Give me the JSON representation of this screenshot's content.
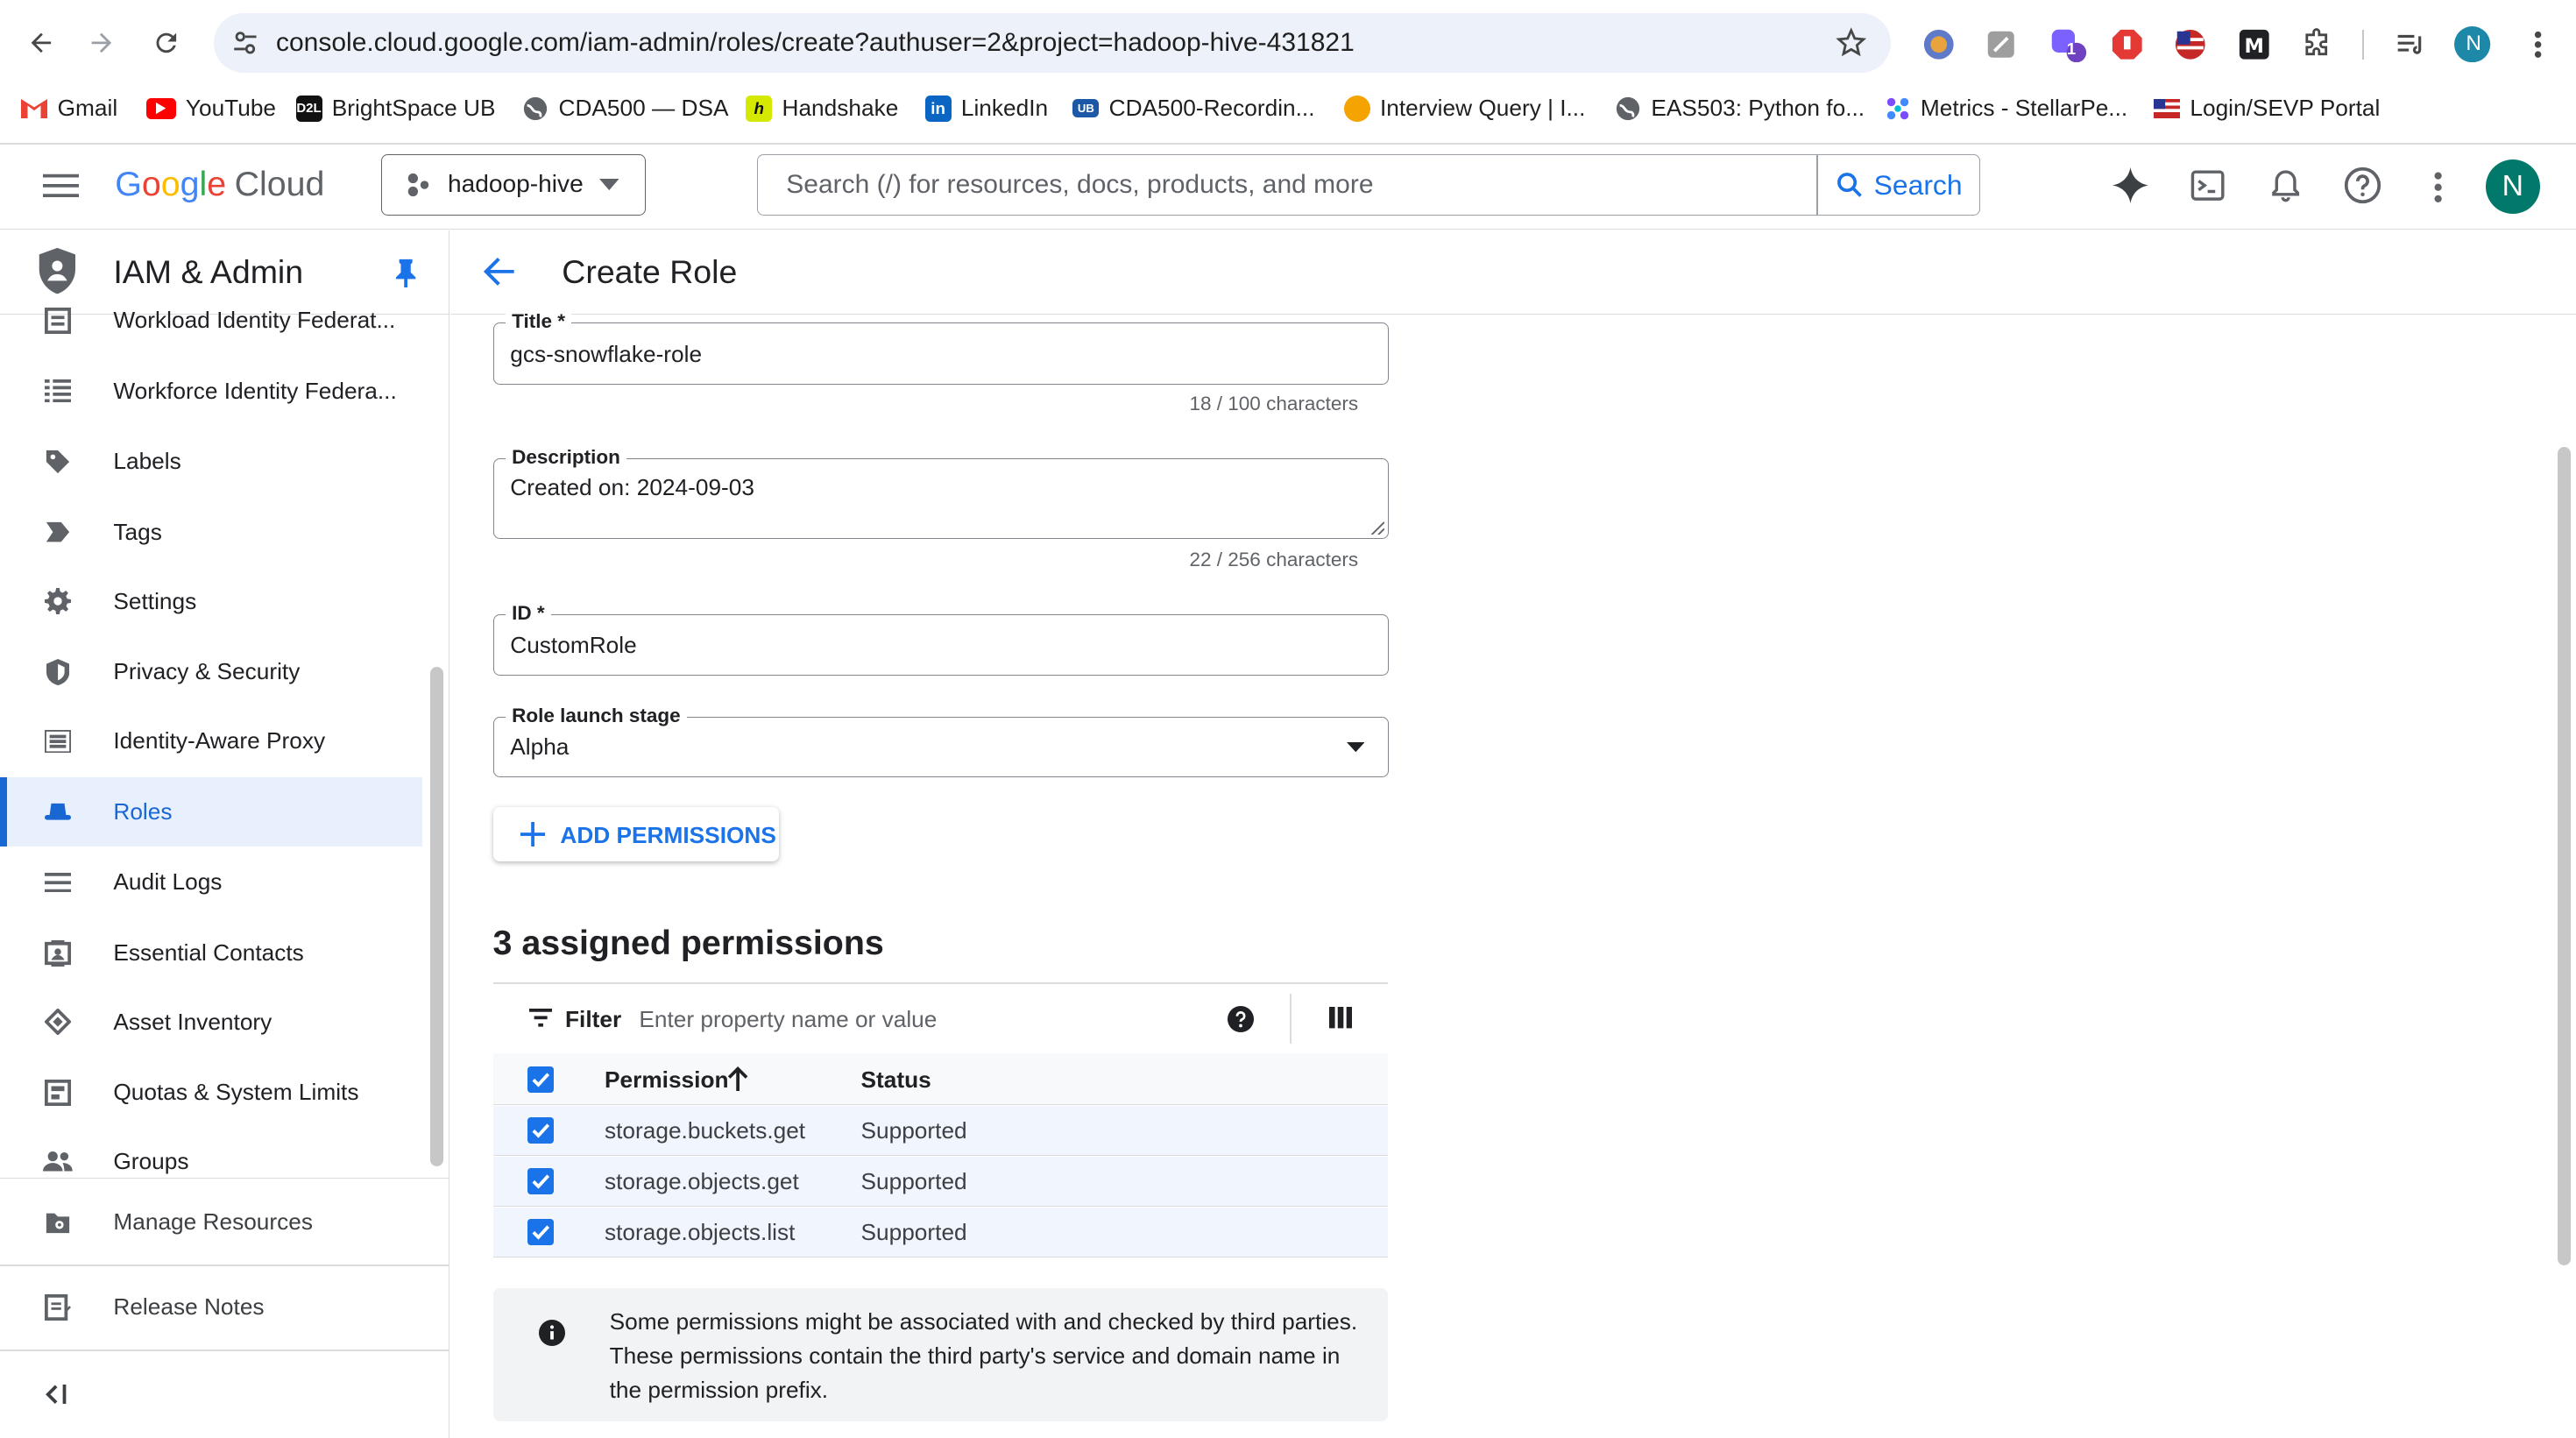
{
  "browser": {
    "url": "console.cloud.google.com/iam-admin/roles/create?authuser=2&project=hadoop-hive-431821",
    "profile_initial": "N",
    "extension_badge": "1",
    "bookmarks": [
      {
        "label": "Gmail",
        "icon": "gmail-icon"
      },
      {
        "label": "YouTube",
        "icon": "youtube-icon"
      },
      {
        "label": "BrightSpace UB",
        "icon": "d2l-icon"
      },
      {
        "label": "CDA500 — DSA",
        "icon": "globe-icon"
      },
      {
        "label": "Handshake",
        "icon": "handshake-icon"
      },
      {
        "label": "LinkedIn",
        "icon": "linkedin-icon"
      },
      {
        "label": "CDA500-Recordin...",
        "icon": "recording-icon"
      },
      {
        "label": "Interview Query | I...",
        "icon": "interview-query-icon"
      },
      {
        "label": "EAS503: Python fo...",
        "icon": "globe-icon"
      },
      {
        "label": "Metrics - StellarPe...",
        "icon": "metrics-icon"
      },
      {
        "label": "Login/SEVP Portal",
        "icon": "flag-icon"
      }
    ]
  },
  "header": {
    "logo_text": "Cloud",
    "project": "hadoop-hive",
    "search_placeholder": "Search (/) for resources, docs, products, and more",
    "search_button": "Search",
    "avatar_initial": "N"
  },
  "sidebar": {
    "title": "IAM & Admin",
    "items": [
      {
        "label": "Workload Identity Federat...",
        "icon": "workload-identity-icon"
      },
      {
        "label": "Workforce Identity Federa...",
        "icon": "workforce-identity-icon"
      },
      {
        "label": "Labels",
        "icon": "label-icon"
      },
      {
        "label": "Tags",
        "icon": "tag-icon"
      },
      {
        "label": "Settings",
        "icon": "gear-icon"
      },
      {
        "label": "Privacy & Security",
        "icon": "shield-icon"
      },
      {
        "label": "Identity-Aware Proxy",
        "icon": "proxy-icon"
      },
      {
        "label": "Roles",
        "icon": "roles-hat-icon",
        "active": true
      },
      {
        "label": "Audit Logs",
        "icon": "list-icon"
      },
      {
        "label": "Essential Contacts",
        "icon": "contacts-icon"
      },
      {
        "label": "Asset Inventory",
        "icon": "asset-icon"
      },
      {
        "label": "Quotas & System Limits",
        "icon": "quota-icon"
      },
      {
        "label": "Groups",
        "icon": "groups-icon"
      }
    ],
    "footer": [
      {
        "label": "Manage Resources",
        "icon": "manage-resources-icon"
      },
      {
        "label": "Release Notes",
        "icon": "release-notes-icon"
      }
    ]
  },
  "page": {
    "title": "Create Role",
    "form": {
      "title_label": "Title *",
      "title_value": "gcs-snowflake-role",
      "title_counter": "18 / 100 characters",
      "description_label": "Description",
      "description_value": "Created on: 2024-09-03",
      "description_counter": "22 / 256 characters",
      "id_label": "ID *",
      "id_value": "CustomRole",
      "stage_label": "Role launch stage",
      "stage_value": "Alpha"
    },
    "add_permissions_label": "ADD PERMISSIONS",
    "assigned_heading": "3 assigned permissions",
    "filter_label": "Filter",
    "filter_placeholder": "Enter property name or value",
    "table": {
      "columns": [
        "Permission",
        "Status"
      ],
      "rows": [
        {
          "permission": "storage.buckets.get",
          "status": "Supported",
          "checked": true
        },
        {
          "permission": "storage.objects.get",
          "status": "Supported",
          "checked": true
        },
        {
          "permission": "storage.objects.list",
          "status": "Supported",
          "checked": true
        }
      ]
    },
    "info_lines": [
      "Some permissions might be associated with and checked by third parties.",
      "These permissions contain the third party's service and domain name in",
      "the permission prefix."
    ]
  },
  "colors": {
    "accent": "#1a73e8",
    "active_bg": "#e8f0fe",
    "border": "#dadce0"
  }
}
